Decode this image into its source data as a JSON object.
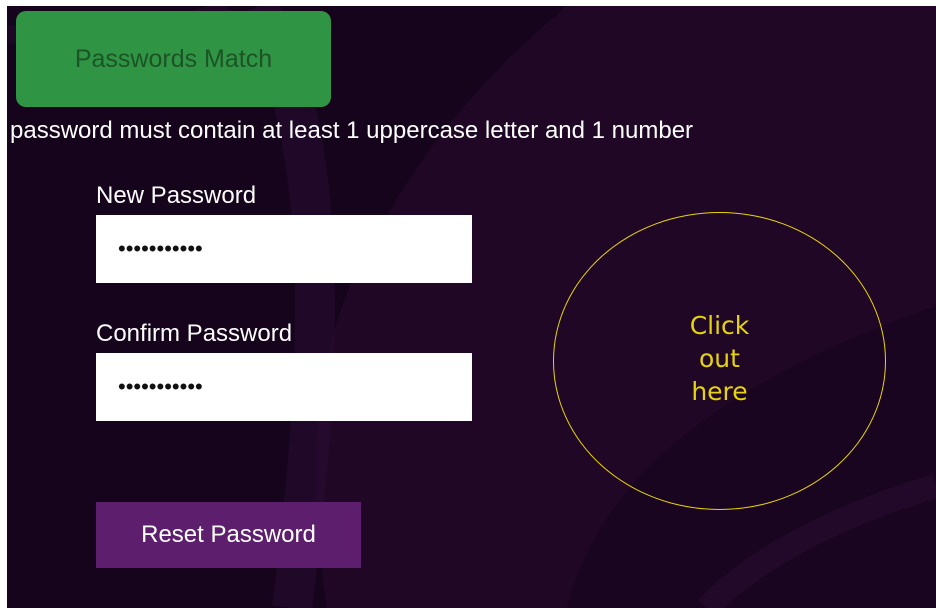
{
  "status": {
    "text": "Passwords Match",
    "color": "#2f9444"
  },
  "rule": {
    "text": "password must contain at least 1 uppercase letter and 1 number"
  },
  "new_password": {
    "label": "New Password",
    "value": "Password123"
  },
  "confirm_password": {
    "label": "Confirm Password",
    "value": "Password123"
  },
  "reset_button": {
    "label": "Reset Password",
    "color": "#5e1e6e"
  },
  "click_zone": {
    "lines": [
      "Click",
      "out",
      "here"
    ],
    "color": "#e6d40a"
  },
  "theme": {
    "background": "#16041c"
  }
}
